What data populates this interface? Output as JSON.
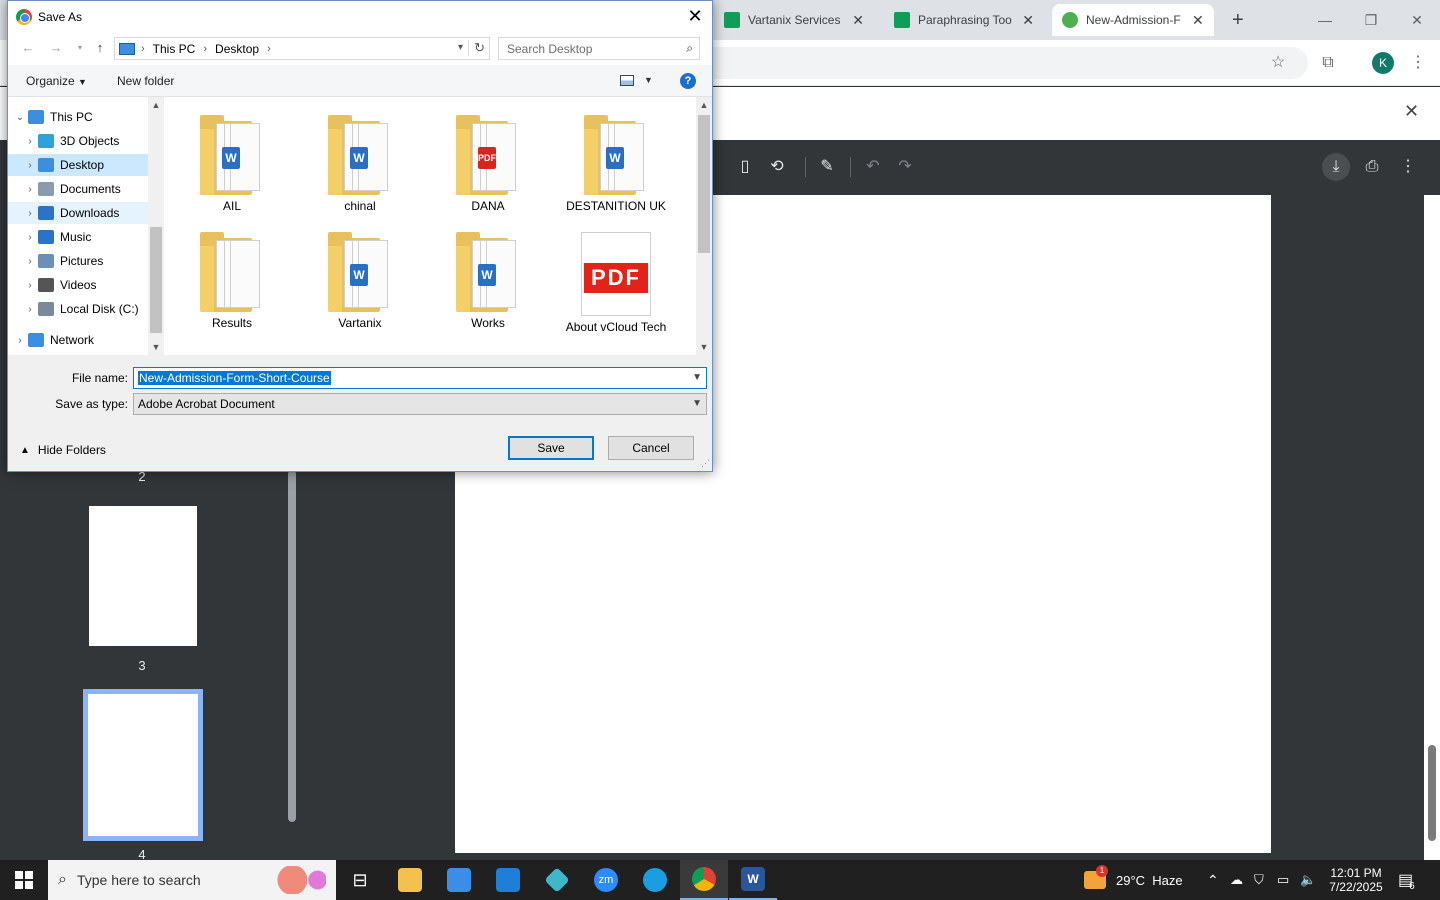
{
  "browser": {
    "tabs": [
      {
        "title": "Vartanix Services S",
        "color": "#0f9d58"
      },
      {
        "title": "Paraphrasing Tool",
        "color": "#0f9d58"
      },
      {
        "title": "New-Admission-F",
        "color": "#4caf50"
      }
    ],
    "new_tab": "+",
    "profile_initial": "K"
  },
  "pdf_viewer": {
    "thumbnails": [
      "2",
      "3",
      "4"
    ]
  },
  "dialog": {
    "title": "Save As",
    "breadcrumb": [
      "This PC",
      "Desktop"
    ],
    "search_placeholder": "Search Desktop",
    "organize": "Organize",
    "new_folder": "New folder",
    "nav_tree": [
      {
        "label": "This PC",
        "expanded": true,
        "icon": "pc-icon",
        "color": "#3b8fde"
      },
      {
        "label": "3D Objects",
        "icon": "3d-objects-icon",
        "color": "#2fa3d8"
      },
      {
        "label": "Desktop",
        "icon": "desktop-icon",
        "color": "#3b8fde",
        "selected": true
      },
      {
        "label": "Documents",
        "icon": "documents-icon",
        "color": "#8a9bb0"
      },
      {
        "label": "Downloads",
        "icon": "downloads-icon",
        "color": "#2a73c9",
        "hover": true
      },
      {
        "label": "Music",
        "icon": "music-icon",
        "color": "#2a73c9"
      },
      {
        "label": "Pictures",
        "icon": "pictures-icon",
        "color": "#6b8fb5"
      },
      {
        "label": "Videos",
        "icon": "videos-icon",
        "color": "#555555"
      },
      {
        "label": "Local Disk (C:)",
        "icon": "disk-icon",
        "color": "#7a8a99"
      },
      {
        "label": "Network",
        "icon": "network-icon",
        "color": "#3b8fde"
      }
    ],
    "files": [
      {
        "name": "AIL",
        "kind": "folder-word"
      },
      {
        "name": "chinal",
        "kind": "folder-word"
      },
      {
        "name": "DANA",
        "kind": "folder-pdf"
      },
      {
        "name": "DESTANITION UK",
        "kind": "folder-word"
      },
      {
        "name": "Results",
        "kind": "folder"
      },
      {
        "name": "Vartanix",
        "kind": "folder-word"
      },
      {
        "name": "Works",
        "kind": "folder-word"
      },
      {
        "name": "About vCloud Tech",
        "kind": "pdf"
      }
    ],
    "file_name_label": "File name:",
    "file_name_value": "New-Admission-Form-Short-Course",
    "save_type_label": "Save as type:",
    "save_type_value": "Adobe Acrobat Document",
    "hide_folders": "Hide Folders",
    "save_button": "Save",
    "cancel_button": "Cancel",
    "accent": "#0078d7"
  },
  "taskbar": {
    "search_placeholder": "Type here to search",
    "weather": "29°C  Haze",
    "weather_badge": "1",
    "time": "12:01 PM",
    "date": "7/22/2025",
    "notifications": "6"
  }
}
